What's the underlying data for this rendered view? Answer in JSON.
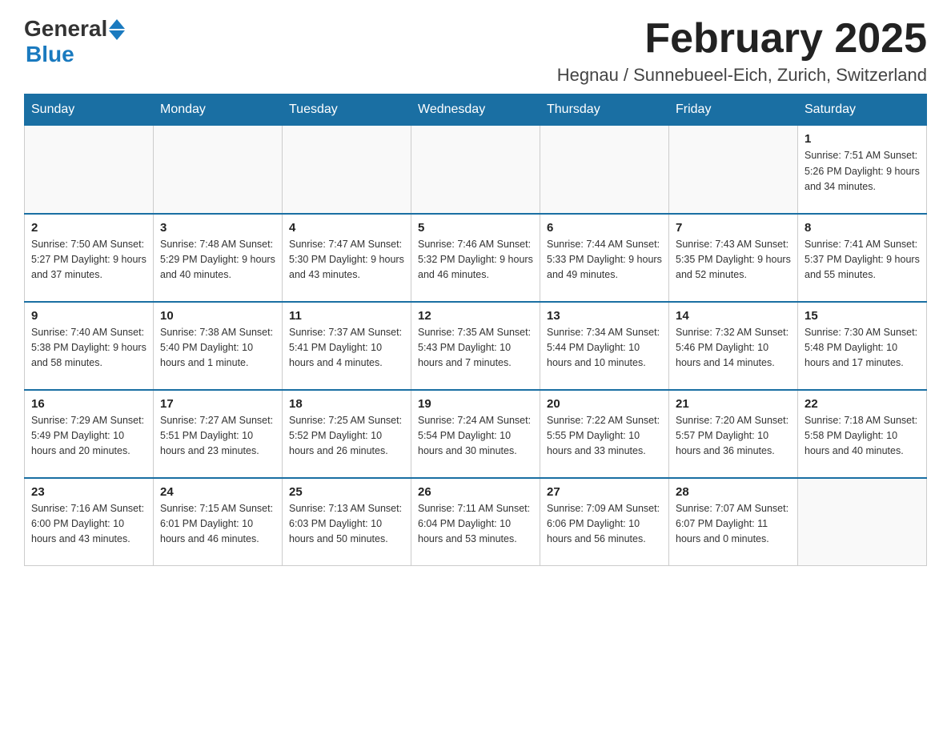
{
  "logo": {
    "general": "General",
    "blue": "Blue"
  },
  "header": {
    "title": "February 2025",
    "subtitle": "Hegnau / Sunnebueel-Eich, Zurich, Switzerland"
  },
  "weekdays": [
    "Sunday",
    "Monday",
    "Tuesday",
    "Wednesday",
    "Thursday",
    "Friday",
    "Saturday"
  ],
  "weeks": [
    [
      {
        "day": "",
        "info": ""
      },
      {
        "day": "",
        "info": ""
      },
      {
        "day": "",
        "info": ""
      },
      {
        "day": "",
        "info": ""
      },
      {
        "day": "",
        "info": ""
      },
      {
        "day": "",
        "info": ""
      },
      {
        "day": "1",
        "info": "Sunrise: 7:51 AM\nSunset: 5:26 PM\nDaylight: 9 hours and 34 minutes."
      }
    ],
    [
      {
        "day": "2",
        "info": "Sunrise: 7:50 AM\nSunset: 5:27 PM\nDaylight: 9 hours and 37 minutes."
      },
      {
        "day": "3",
        "info": "Sunrise: 7:48 AM\nSunset: 5:29 PM\nDaylight: 9 hours and 40 minutes."
      },
      {
        "day": "4",
        "info": "Sunrise: 7:47 AM\nSunset: 5:30 PM\nDaylight: 9 hours and 43 minutes."
      },
      {
        "day": "5",
        "info": "Sunrise: 7:46 AM\nSunset: 5:32 PM\nDaylight: 9 hours and 46 minutes."
      },
      {
        "day": "6",
        "info": "Sunrise: 7:44 AM\nSunset: 5:33 PM\nDaylight: 9 hours and 49 minutes."
      },
      {
        "day": "7",
        "info": "Sunrise: 7:43 AM\nSunset: 5:35 PM\nDaylight: 9 hours and 52 minutes."
      },
      {
        "day": "8",
        "info": "Sunrise: 7:41 AM\nSunset: 5:37 PM\nDaylight: 9 hours and 55 minutes."
      }
    ],
    [
      {
        "day": "9",
        "info": "Sunrise: 7:40 AM\nSunset: 5:38 PM\nDaylight: 9 hours and 58 minutes."
      },
      {
        "day": "10",
        "info": "Sunrise: 7:38 AM\nSunset: 5:40 PM\nDaylight: 10 hours and 1 minute."
      },
      {
        "day": "11",
        "info": "Sunrise: 7:37 AM\nSunset: 5:41 PM\nDaylight: 10 hours and 4 minutes."
      },
      {
        "day": "12",
        "info": "Sunrise: 7:35 AM\nSunset: 5:43 PM\nDaylight: 10 hours and 7 minutes."
      },
      {
        "day": "13",
        "info": "Sunrise: 7:34 AM\nSunset: 5:44 PM\nDaylight: 10 hours and 10 minutes."
      },
      {
        "day": "14",
        "info": "Sunrise: 7:32 AM\nSunset: 5:46 PM\nDaylight: 10 hours and 14 minutes."
      },
      {
        "day": "15",
        "info": "Sunrise: 7:30 AM\nSunset: 5:48 PM\nDaylight: 10 hours and 17 minutes."
      }
    ],
    [
      {
        "day": "16",
        "info": "Sunrise: 7:29 AM\nSunset: 5:49 PM\nDaylight: 10 hours and 20 minutes."
      },
      {
        "day": "17",
        "info": "Sunrise: 7:27 AM\nSunset: 5:51 PM\nDaylight: 10 hours and 23 minutes."
      },
      {
        "day": "18",
        "info": "Sunrise: 7:25 AM\nSunset: 5:52 PM\nDaylight: 10 hours and 26 minutes."
      },
      {
        "day": "19",
        "info": "Sunrise: 7:24 AM\nSunset: 5:54 PM\nDaylight: 10 hours and 30 minutes."
      },
      {
        "day": "20",
        "info": "Sunrise: 7:22 AM\nSunset: 5:55 PM\nDaylight: 10 hours and 33 minutes."
      },
      {
        "day": "21",
        "info": "Sunrise: 7:20 AM\nSunset: 5:57 PM\nDaylight: 10 hours and 36 minutes."
      },
      {
        "day": "22",
        "info": "Sunrise: 7:18 AM\nSunset: 5:58 PM\nDaylight: 10 hours and 40 minutes."
      }
    ],
    [
      {
        "day": "23",
        "info": "Sunrise: 7:16 AM\nSunset: 6:00 PM\nDaylight: 10 hours and 43 minutes."
      },
      {
        "day": "24",
        "info": "Sunrise: 7:15 AM\nSunset: 6:01 PM\nDaylight: 10 hours and 46 minutes."
      },
      {
        "day": "25",
        "info": "Sunrise: 7:13 AM\nSunset: 6:03 PM\nDaylight: 10 hours and 50 minutes."
      },
      {
        "day": "26",
        "info": "Sunrise: 7:11 AM\nSunset: 6:04 PM\nDaylight: 10 hours and 53 minutes."
      },
      {
        "day": "27",
        "info": "Sunrise: 7:09 AM\nSunset: 6:06 PM\nDaylight: 10 hours and 56 minutes."
      },
      {
        "day": "28",
        "info": "Sunrise: 7:07 AM\nSunset: 6:07 PM\nDaylight: 11 hours and 0 minutes."
      },
      {
        "day": "",
        "info": ""
      }
    ]
  ]
}
